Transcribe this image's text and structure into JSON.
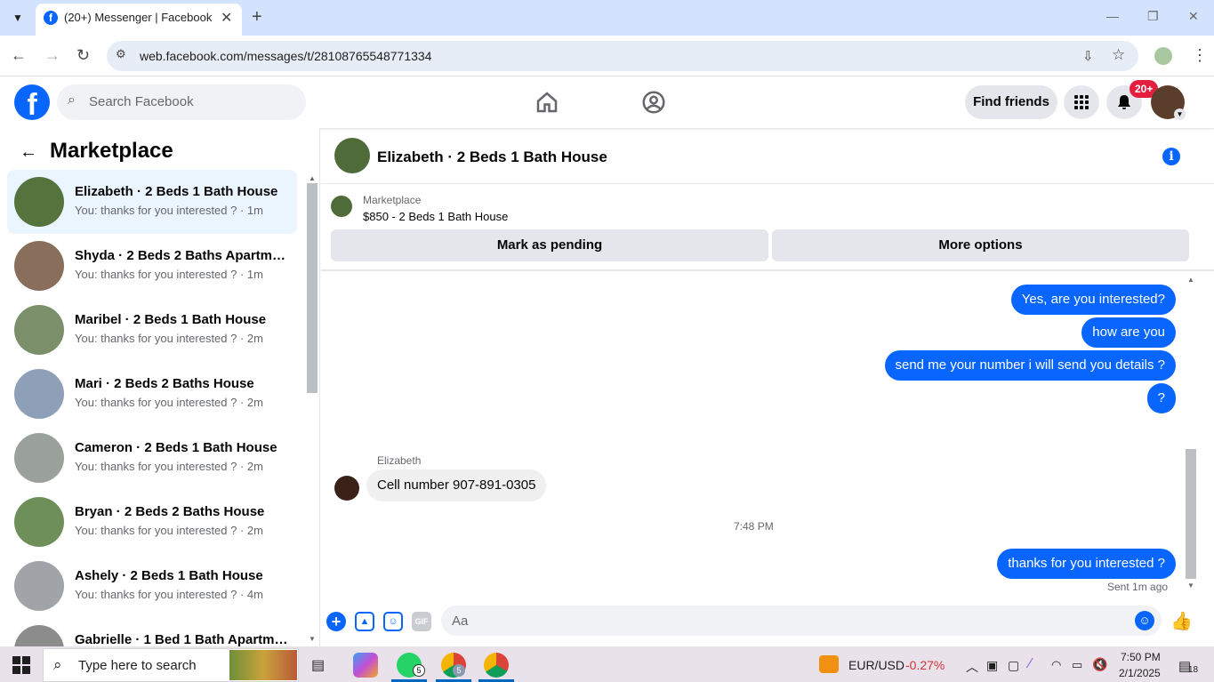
{
  "browser": {
    "tab_title": "(20+) Messenger | Facebook",
    "url": "web.facebook.com/messages/t/28108765548771334"
  },
  "fb_header": {
    "search_placeholder": "Search Facebook",
    "find_friends": "Find friends",
    "notification_badge": "20+"
  },
  "sidebar": {
    "title": "Marketplace",
    "conversations": [
      {
        "name": "Elizabeth · 2 Beds 1 Bath House",
        "preview": "You: thanks for you interested ? · 1m",
        "color": "#55733d"
      },
      {
        "name": "Shyda · 2 Beds 2 Baths Apartme...",
        "preview": "You: thanks for you interested ? · 1m",
        "color": "#8a6e5c"
      },
      {
        "name": "Maribel · 2 Beds 1 Bath House",
        "preview": "You: thanks for you interested ? · 2m",
        "color": "#7a8f6a"
      },
      {
        "name": "Mari · 2 Beds 2 Baths House",
        "preview": "You: thanks for you interested ? · 2m",
        "color": "#8ea0b8"
      },
      {
        "name": "Cameron · 2 Beds 1 Bath House",
        "preview": "You: thanks for you interested ? · 2m",
        "color": "#9aa09a"
      },
      {
        "name": "Bryan · 2 Beds 2 Baths House",
        "preview": "You: thanks for you interested ? · 2m",
        "color": "#6e8f59"
      },
      {
        "name": "Ashely · 2 Beds 1 Bath House",
        "preview": "You: thanks for you interested ? · 4m",
        "color": "#a0a4a8"
      },
      {
        "name": "Gabrielle · 1 Bed 1 Bath Apartme...",
        "preview": "",
        "color": "#8c8c8c"
      }
    ]
  },
  "chat": {
    "title": "Elizabeth · 2 Beds 1 Bath House",
    "listing_label": "Marketplace",
    "listing_price": "$850 - 2 Beds 1 Bath House",
    "mark_pending": "Mark as pending",
    "more_options": "More options",
    "outgoing": [
      "Yes, are you interested?",
      "how are you",
      "send me your number i will send you details ?",
      "?"
    ],
    "sender_name": "Elizabeth",
    "incoming": "Cell number 907-891-0305",
    "timestamp": "7:48 PM",
    "last_outgoing": "thanks for you interested ?",
    "sent_status": "Sent 1m ago",
    "composer_placeholder": "Aa"
  },
  "taskbar": {
    "search_placeholder": "Type here to search",
    "whatsapp_badge": "5",
    "chrome_badge": "5",
    "fx_pair": "EUR/USD",
    "fx_change": "-0.27%",
    "time": "7:50 PM",
    "date": "2/1/2025",
    "notifications": "18"
  },
  "colors": {
    "fb_blue": "#0866ff",
    "selected_row": "#ebf5ff",
    "negative": "#d13438"
  }
}
